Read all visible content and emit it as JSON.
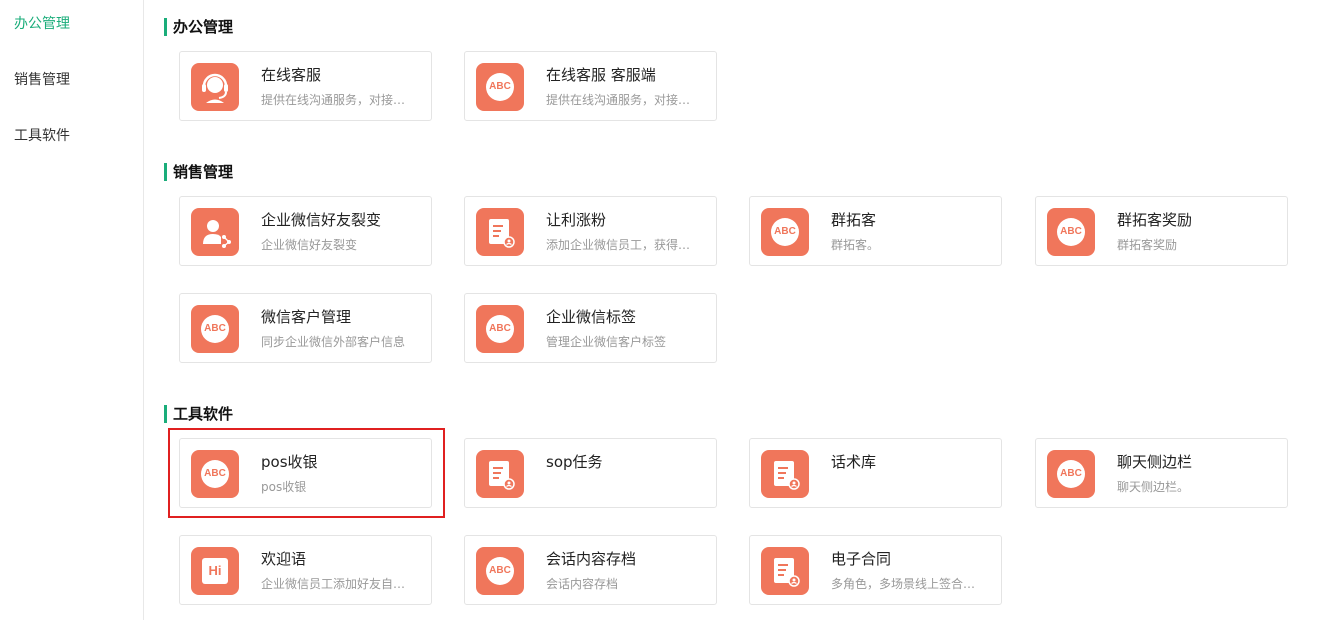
{
  "sidebar": {
    "items": [
      {
        "label": "办公管理",
        "active": true
      },
      {
        "label": "销售管理",
        "active": false
      },
      {
        "label": "工具软件",
        "active": false
      }
    ]
  },
  "sections": [
    {
      "title": "办公管理",
      "apps": [
        {
          "name": "在线客服",
          "desc": "提供在线沟通服务，对接…",
          "icon": "headset-icon"
        },
        {
          "name": "在线客服 客服端",
          "desc": "提供在线沟通服务，对接…",
          "icon": "abc-icon"
        }
      ]
    },
    {
      "title": "销售管理",
      "apps": [
        {
          "name": "企业微信好友裂变",
          "desc": "企业微信好友裂变",
          "icon": "user-share-icon"
        },
        {
          "name": "让利涨粉",
          "desc": "添加企业微信员工，获得…",
          "icon": "document-icon"
        },
        {
          "name": "群拓客",
          "desc": "群拓客。",
          "icon": "abc-icon"
        },
        {
          "name": "群拓客奖励",
          "desc": "群拓客奖励",
          "icon": "abc-icon"
        },
        {
          "name": "微信客户管理",
          "desc": "同步企业微信外部客户信息",
          "icon": "abc-icon"
        },
        {
          "name": "企业微信标签",
          "desc": "管理企业微信客户标签",
          "icon": "abc-icon"
        }
      ]
    },
    {
      "title": "工具软件",
      "apps": [
        {
          "name": "pos收银",
          "desc": "pos收银",
          "icon": "abc-icon"
        },
        {
          "name": "sop任务",
          "desc": "",
          "icon": "document-icon"
        },
        {
          "name": "话术库",
          "desc": "",
          "icon": "document-icon"
        },
        {
          "name": "聊天侧边栏",
          "desc": "聊天侧边栏。",
          "icon": "abc-icon"
        },
        {
          "name": "欢迎语",
          "desc": "企业微信员工添加好友自…",
          "icon": "hi-icon"
        },
        {
          "name": "会话内容存档",
          "desc": "会话内容存档",
          "icon": "abc-icon"
        },
        {
          "name": "电子合同",
          "desc": "多角色，多场景线上签合…",
          "icon": "document-icon"
        }
      ]
    }
  ],
  "icon_text": {
    "abc": "ABC",
    "hi": "Hi"
  },
  "colors": {
    "accent": "#1aad7a",
    "icon_bg": "#f0765b",
    "highlight": "#e02020"
  },
  "highlighted_app": "pos收银"
}
